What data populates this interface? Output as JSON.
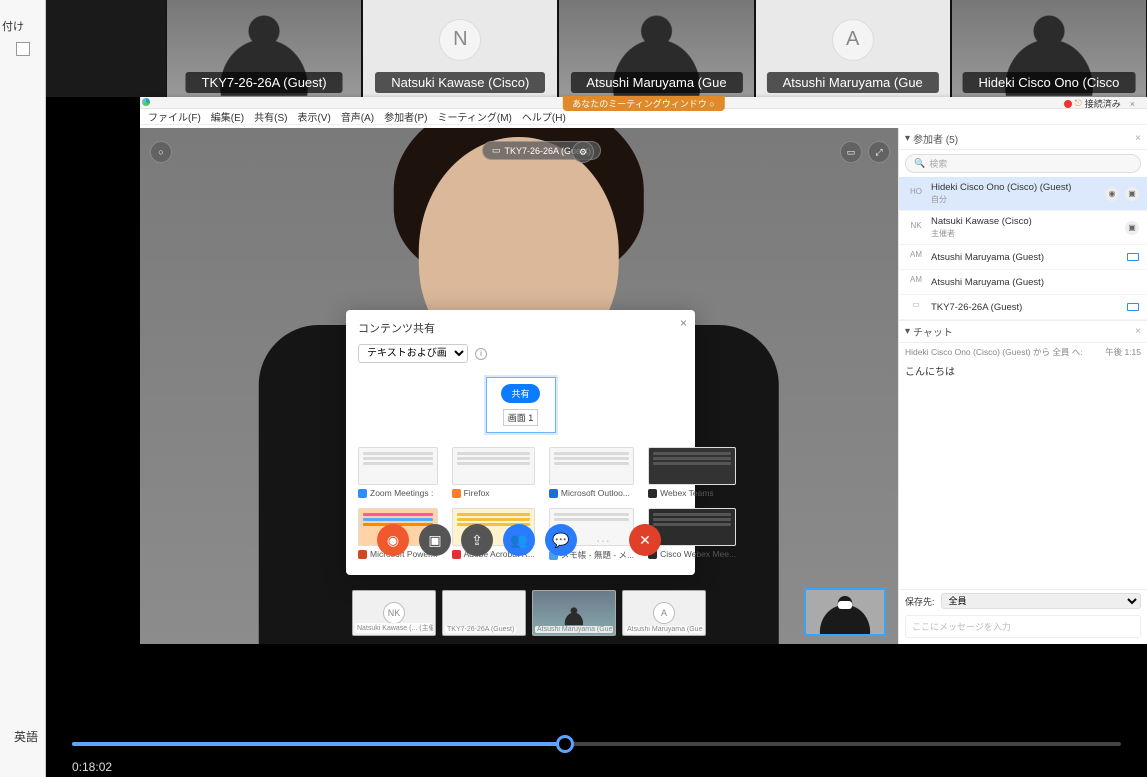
{
  "outer": {
    "top_word": "付け",
    "bottom_word": "英語"
  },
  "gallery": [
    {
      "type": "video",
      "label": "TKY7-26-26A (Guest)"
    },
    {
      "type": "avatar",
      "letter": "N",
      "label": "Natsuki Kawase (Cisco)"
    },
    {
      "type": "video",
      "label": "Atsushi Maruyama (Gue"
    },
    {
      "type": "avatar",
      "letter": "A",
      "label": "Atsushi Maruyama (Gue"
    },
    {
      "type": "video",
      "label": "Hideki Cisco Ono (Cisco"
    }
  ],
  "titlebar": {
    "banner": "あなたのミーティングウィンドウ ○",
    "status": "接続済み"
  },
  "menu": [
    "ファイル(F)",
    "編集(E)",
    "共有(S)",
    "表示(V)",
    "音声(A)",
    "参加者(P)",
    "ミーティング(M)",
    "ヘルプ(H)"
  ],
  "stage": {
    "left_pill": "○",
    "center_pill": "TKY7-26-26A (Guest)",
    "center_settings": "⚙",
    "right_pill1": "▭",
    "right_pill2": "⤢"
  },
  "dialog": {
    "title": "コンテンツ共有",
    "dropdown": "テキストおよび画像で最適化",
    "share_btn": "共有",
    "screen_caption": "画面 1",
    "apps": [
      {
        "color": "#2d8cff",
        "label": "Zoom Meetings :"
      },
      {
        "color": "#ff7b2e",
        "label": "Firefox"
      },
      {
        "color": "#1f6fd0",
        "label": "Microsoft Outloo..."
      },
      {
        "color": "#2a2a2a",
        "label": "Webex Teams"
      },
      {
        "color": "#d24726",
        "label": "Microsoft Power..."
      },
      {
        "color": "#e03030",
        "label": "Adobe Acrobat R..."
      },
      {
        "color": "#4aa0e6",
        "label": "メモ帳 - 無題 - メ..."
      },
      {
        "color": "#2a2a2a",
        "label": "Cisco Webex Mee..."
      }
    ]
  },
  "controls": {
    "mic": "◉",
    "vid": "▣",
    "share": "⇪",
    "participants": "👥",
    "chat": "💬",
    "more": "···",
    "leave": "✕"
  },
  "mini": [
    {
      "type": "circle",
      "letter": "NK",
      "tag": "Natsuki Kawase (... (主催者) 内部"
    },
    {
      "type": "blank",
      "tag": "TKY7-26-26A (Guest)"
    },
    {
      "type": "video",
      "tag": "Atsushi Maruyama (Guest)"
    },
    {
      "type": "circle",
      "letter": "A",
      "tag": "Atsushi Maruyama (Guest)"
    }
  ],
  "participants": {
    "header": "参加者 (5)",
    "search_placeholder": "検索",
    "rows": [
      {
        "av": "HO",
        "name": "Hideki Cisco Ono (Cisco) (Guest)",
        "sub": "自分",
        "sel": true,
        "mic": true,
        "vid": true
      },
      {
        "av": "NK",
        "name": "Natsuki Kawase (Cisco)",
        "sub": "主催者",
        "vid": true
      },
      {
        "av": "AM",
        "name": "Atsushi Maruyama (Guest)",
        "cam": true
      },
      {
        "av": "AM",
        "name": "Atsushi Maruyama (Guest)"
      },
      {
        "av": "▭",
        "name": "TKY7-26-26A (Guest)",
        "cam": true
      }
    ]
  },
  "chat": {
    "header": "チャット",
    "from": "Hideki Cisco Ono (Cisco) (Guest) から 全員 へ:",
    "time": "午後 1:15",
    "msg": "こんにちは",
    "save_label": "保存先:",
    "save_target": "全員",
    "input_placeholder": "ここにメッセージを入力"
  },
  "player": {
    "time": "0:18:02",
    "progress_pct": 47
  }
}
